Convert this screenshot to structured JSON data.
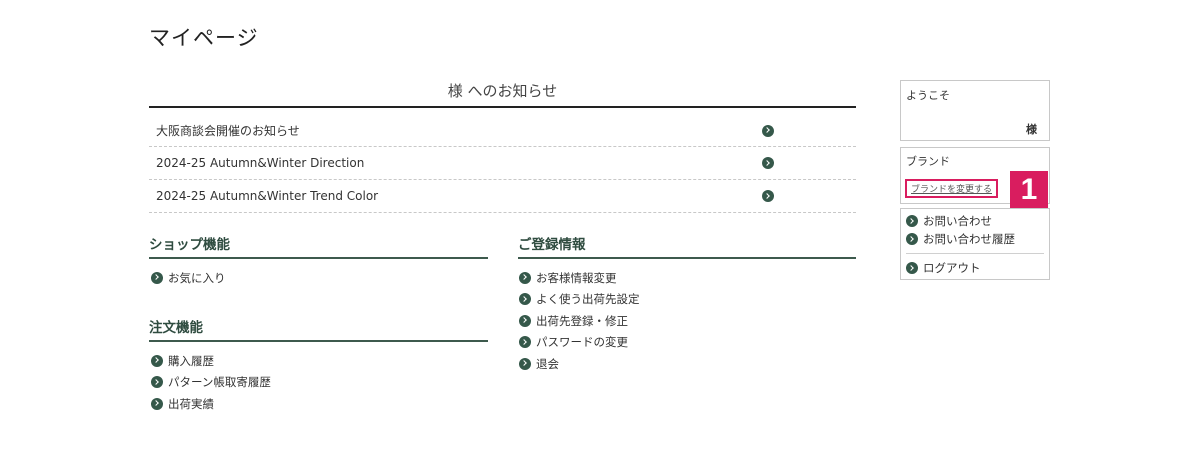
{
  "page": {
    "title": "マイページ"
  },
  "notices": {
    "heading": "様 へのお知らせ",
    "items": [
      {
        "label": "大阪商談会開催のお知らせ"
      },
      {
        "label": "2024-25 Autumn&Winter Direction"
      },
      {
        "label": "2024-25 Autumn&Winter Trend Color"
      }
    ]
  },
  "shop": {
    "title": "ショップ機能",
    "items": [
      "お気に入り"
    ]
  },
  "order": {
    "title": "注文機能",
    "items": [
      "購入履歴",
      "パターン帳取寄履歴",
      "出荷実績"
    ]
  },
  "registration": {
    "title": "ご登録情報",
    "items": [
      "お客様情報変更",
      "よく使う出荷先設定",
      "出荷先登録・修正",
      "パスワードの変更",
      "退会"
    ]
  },
  "sidebar": {
    "welcome_label": "ようこそ",
    "welcome_name": "様",
    "brand_label": "ブランド",
    "brand_change_link": "ブランドを変更する",
    "annotation_number": "1",
    "contact": "お問い合わせ",
    "contact_history": "お問い合わせ履歴",
    "logout": "ログアウト"
  },
  "colors": {
    "accent": "#35584a",
    "highlight": "#d91d5f"
  },
  "icons": {
    "link_arrow": "circle-chevron-right-icon"
  }
}
